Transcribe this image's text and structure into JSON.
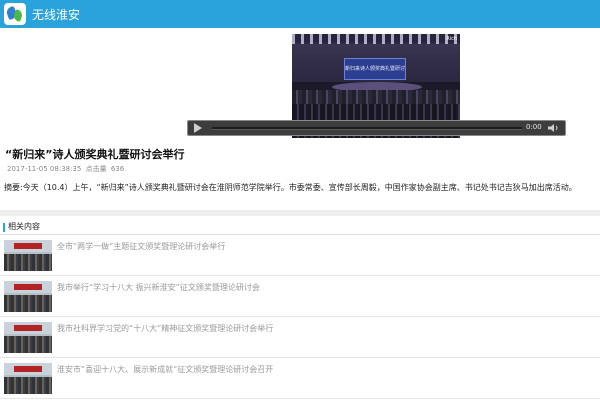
{
  "app": {
    "title": "无线淮安"
  },
  "video": {
    "time": "0:00",
    "screen_text": "新归来诗人颁奖典礼暨研讨会",
    "watermark": "Rich"
  },
  "article": {
    "title": "“新归来”诗人颁奖典礼暨研讨会举行",
    "date": "2017-11-05 08:38:35",
    "views_label": "点击量",
    "views": "636",
    "summary": "摘要:今天（10.4）上午，“新归来”诗人颁奖典礼暨研讨会在淮阴师范学院举行。市委常委、宣传部长周毅，中国作家协会副主席、书记处书记吉狄马加出席活动。"
  },
  "related": {
    "heading": "相关内容",
    "items": [
      {
        "title": "全市“两学一做”主题征文颁奖暨理论研讨会举行"
      },
      {
        "title": "我市举行“学习十八大 振兴新淮安”征文颁奖暨理论研讨会"
      },
      {
        "title": "我市社科界学习党的“十八大”精神征文颁奖暨理论研讨会举行"
      },
      {
        "title": "淮安市“喜迎十八大、展示新成就”征文颁奖暨理论研讨会召开"
      }
    ]
  },
  "colors": {
    "brand": "#2aa3dc",
    "player_bar": "#3d3d3d"
  },
  "icons": {
    "play": "play-icon",
    "volume": "volume-icon",
    "logo": "app-logo-icon"
  }
}
